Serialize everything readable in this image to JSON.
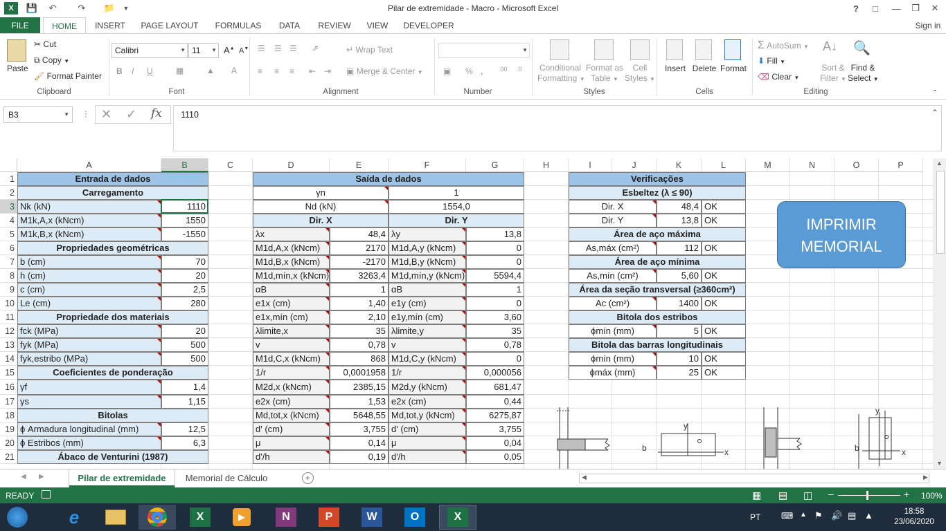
{
  "window": {
    "title": "Pilar de extremidade - Macro - Microsoft Excel",
    "signin": "Sign in"
  },
  "tabs": [
    "FILE",
    "HOME",
    "INSERT",
    "PAGE LAYOUT",
    "FORMULAS",
    "DATA",
    "REVIEW",
    "VIEW",
    "DEVELOPER"
  ],
  "ribbon": {
    "clipboard": {
      "label": "Clipboard",
      "paste": "Paste",
      "cut": "Cut",
      "copy": "Copy",
      "format_painter": "Format Painter"
    },
    "font": {
      "label": "Font",
      "family": "Calibri",
      "size": "11"
    },
    "alignment": {
      "label": "Alignment",
      "wrap": "Wrap Text",
      "merge": "Merge & Center"
    },
    "number": {
      "label": "Number",
      "format": ""
    },
    "styles": {
      "label": "Styles",
      "conditional": [
        "Conditional",
        "Formatting"
      ],
      "format_table": [
        "Format as",
        "Table"
      ],
      "cell_styles": [
        "Cell",
        "Styles"
      ]
    },
    "cells": {
      "label": "Cells",
      "insert": "Insert",
      "delete": "Delete",
      "format": "Format"
    },
    "editing": {
      "label": "Editing",
      "autosum": "AutoSum",
      "fill": "Fill",
      "clear": "Clear",
      "sort": [
        "Sort &",
        "Filter"
      ],
      "find": [
        "Find &",
        "Select"
      ]
    }
  },
  "formula_bar": {
    "namebox": "B3",
    "fx": "fx",
    "value": "1110"
  },
  "columns": [
    "A",
    "B",
    "C",
    "D",
    "E",
    "F",
    "G",
    "H",
    "I",
    "J",
    "K",
    "L",
    "M",
    "N",
    "O",
    "P"
  ],
  "rows": [
    "1",
    "2",
    "3",
    "4",
    "5",
    "6",
    "7",
    "8",
    "9",
    "10",
    "11",
    "12",
    "13",
    "14",
    "15",
    "16",
    "17",
    "18",
    "19",
    "20",
    "21"
  ],
  "entrada": {
    "title": "Entrada de dados",
    "s_carreg": "Carregamento",
    "r3": [
      "Nk (kN)",
      "1110"
    ],
    "r4": [
      "M1k,A,x (kNcm)",
      "1550"
    ],
    "r5": [
      "M1k,B,x (kNcm)",
      "-1550"
    ],
    "s_geo": "Propriedades geométricas",
    "r7": [
      "b (cm)",
      "70"
    ],
    "r8": [
      "h (cm)",
      "20"
    ],
    "r9": [
      "c (cm)",
      "2,5"
    ],
    "r10": [
      "Le (cm)",
      "280"
    ],
    "s_mat": "Propriedade dos materiais",
    "r12": [
      "fck (MPa)",
      "20"
    ],
    "r13": [
      "fyk (MPa)",
      "500"
    ],
    "r14": [
      "fyk,estribo (MPa)",
      "500"
    ],
    "s_coef": "Coeficientes de ponderação",
    "r16": [
      "γf",
      "1,4"
    ],
    "r17": [
      "γs",
      "1,15"
    ],
    "s_bit": "Bitolas",
    "r19": [
      "ϕ Armadura longitudinal (mm)",
      "12,5"
    ],
    "r20": [
      "ϕ Estribos (mm)",
      "6,3"
    ],
    "s_abaco": "Ábaco de Venturini (1987)"
  },
  "saida": {
    "title": "Saída de dados",
    "r2": [
      "γn",
      "1"
    ],
    "r3": [
      "Nd (kN)",
      "1554,0"
    ],
    "dirx": "Dir. X",
    "diry": "Dir. Y",
    "rows": [
      [
        "λx",
        "48,4",
        "λy",
        "13,8"
      ],
      [
        "M1d,A,x (kNcm)",
        "2170",
        "M1d,A,y (kNcm)",
        "0"
      ],
      [
        "M1d,B,x (kNcm)",
        "-2170",
        "M1d,B,y (kNcm)",
        "0"
      ],
      [
        "M1d,mín,x (kNcm)",
        "3263,4",
        "M1d,mín,y (kNcm)",
        "5594,4"
      ],
      [
        "αB",
        "1",
        "αB",
        "1"
      ],
      [
        "e1x (cm)",
        "1,40",
        "e1y (cm)",
        "0"
      ],
      [
        "e1x,mín (cm)",
        "2,10",
        "e1y,mín (cm)",
        "3,60"
      ],
      [
        "λlimite,x",
        "35",
        "λlimite,y",
        "35"
      ],
      [
        "v",
        "0,78",
        "v",
        "0,78"
      ],
      [
        "M1d,C,x (kNcm)",
        "868",
        "M1d,C,y (kNcm)",
        "0"
      ],
      [
        "1/r",
        "0,0001958",
        "1/r",
        "0,000056"
      ],
      [
        "M2d,x (kNcm)",
        "2385,15",
        "M2d,y (kNcm)",
        "681,47"
      ],
      [
        "e2x (cm)",
        "1,53",
        "e2x (cm)",
        "0,44"
      ],
      [
        "Md,tot,x (kNcm)",
        "5648,55",
        "Md,tot,y (kNcm)",
        "6275,87"
      ],
      [
        "d' (cm)",
        "3,755",
        "d' (cm)",
        "3,755"
      ],
      [
        "μ",
        "0,14",
        "μ",
        "0,04"
      ],
      [
        "d'/h",
        "0,19",
        "d'/h",
        "0,05"
      ]
    ]
  },
  "verif": {
    "title": "Verificações",
    "rows": [
      {
        "type": "sec",
        "text": "Esbeltez (λ ≤ 90)"
      },
      {
        "type": "row",
        "label": "Dir. X",
        "value": "48,4",
        "status": "OK"
      },
      {
        "type": "row",
        "label": "Dir. Y",
        "value": "13,8",
        "status": "OK"
      },
      {
        "type": "sec",
        "text": "Área de aço máxima"
      },
      {
        "type": "row",
        "label": "As,máx (cm²)",
        "value": "112",
        "status": "OK"
      },
      {
        "type": "sec",
        "text": "Área de aço mínima"
      },
      {
        "type": "row",
        "label": "As,mín (cm²)",
        "value": "5,60",
        "status": "OK"
      },
      {
        "type": "sec",
        "text": "Área da seção transversal (≥360cm²)"
      },
      {
        "type": "row",
        "label": "Ac (cm²)",
        "value": "1400",
        "status": "OK"
      },
      {
        "type": "sec",
        "text": "Bitola dos estribos"
      },
      {
        "type": "row",
        "label": "ϕmín (mm)",
        "value": "5",
        "status": "OK"
      },
      {
        "type": "sec",
        "text": "Bitola das barras longitudinais"
      },
      {
        "type": "row",
        "label": "ϕmín (mm)",
        "value": "10",
        "status": "OK"
      },
      {
        "type": "row",
        "label": "ϕmáx (mm)",
        "value": "25",
        "status": "OK"
      }
    ]
  },
  "button": {
    "line1": "IMPRIMIR",
    "line2": "MEMORIAL"
  },
  "diagram_labels": {
    "b": "b",
    "x": "x",
    "y": "y"
  },
  "sheets": [
    "Pilar de extremidade",
    "Memorial de Cálculo"
  ],
  "status": {
    "ready": "READY",
    "zoom": "100%"
  },
  "taskbar": {
    "lang": "PT",
    "time": "18:58",
    "date": "23/06/2020"
  },
  "colors": {
    "excel_green": "#217346",
    "header_blue": "#9dc3e6",
    "light_blue": "#ddebf7",
    "button_blue": "#5b9bd5"
  }
}
